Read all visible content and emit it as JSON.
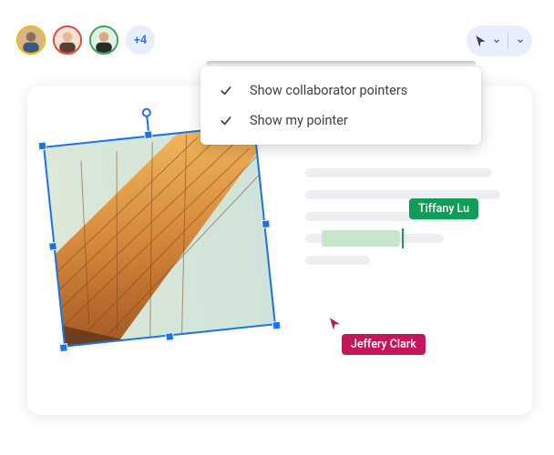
{
  "collaborators": {
    "avatars": [
      {
        "name": "collaborator-1",
        "ring": "#f4b400"
      },
      {
        "name": "collaborator-2",
        "ring": "#ea4335"
      },
      {
        "name": "collaborator-3",
        "ring": "#34a853"
      }
    ],
    "overflow_label": "+4"
  },
  "toolbar": {
    "cursor_button": "pointer-mode"
  },
  "dropdown": {
    "items": [
      {
        "label": "Show collaborator pointers",
        "checked": true
      },
      {
        "label": "Show my pointer",
        "checked": true
      }
    ]
  },
  "cursors": {
    "green": {
      "name": "Tiffany Lu",
      "color": "#0f9d58"
    },
    "magenta": {
      "name": "Jeffery Clark",
      "color": "#c2185b"
    }
  },
  "image": {
    "alt": "building-photo",
    "selected": true
  }
}
